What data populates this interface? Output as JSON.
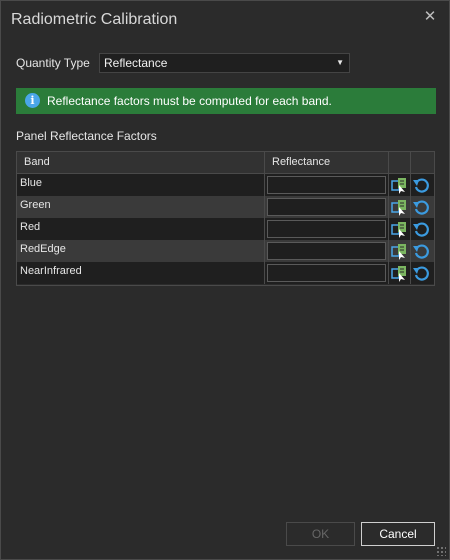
{
  "window": {
    "title": "Radiometric Calibration",
    "close_icon": "close-icon"
  },
  "quantity_type": {
    "label": "Quantity Type",
    "value": "Reflectance"
  },
  "banner": {
    "message": "Reflectance factors must be computed for each band.",
    "color": "#2b7c3a",
    "icon": "info-icon"
  },
  "grid": {
    "label": "Panel Reflectance Factors",
    "columns": [
      "Band",
      "Reflectance",
      "",
      ""
    ],
    "rows": [
      {
        "band": "Blue",
        "reflectance": ""
      },
      {
        "band": "Green",
        "reflectance": ""
      },
      {
        "band": "Red",
        "reflectance": ""
      },
      {
        "band": "RedEdge",
        "reflectance": ""
      },
      {
        "band": "NearInfrared",
        "reflectance": ""
      }
    ]
  },
  "buttons": {
    "ok": "OK",
    "cancel": "Cancel"
  }
}
